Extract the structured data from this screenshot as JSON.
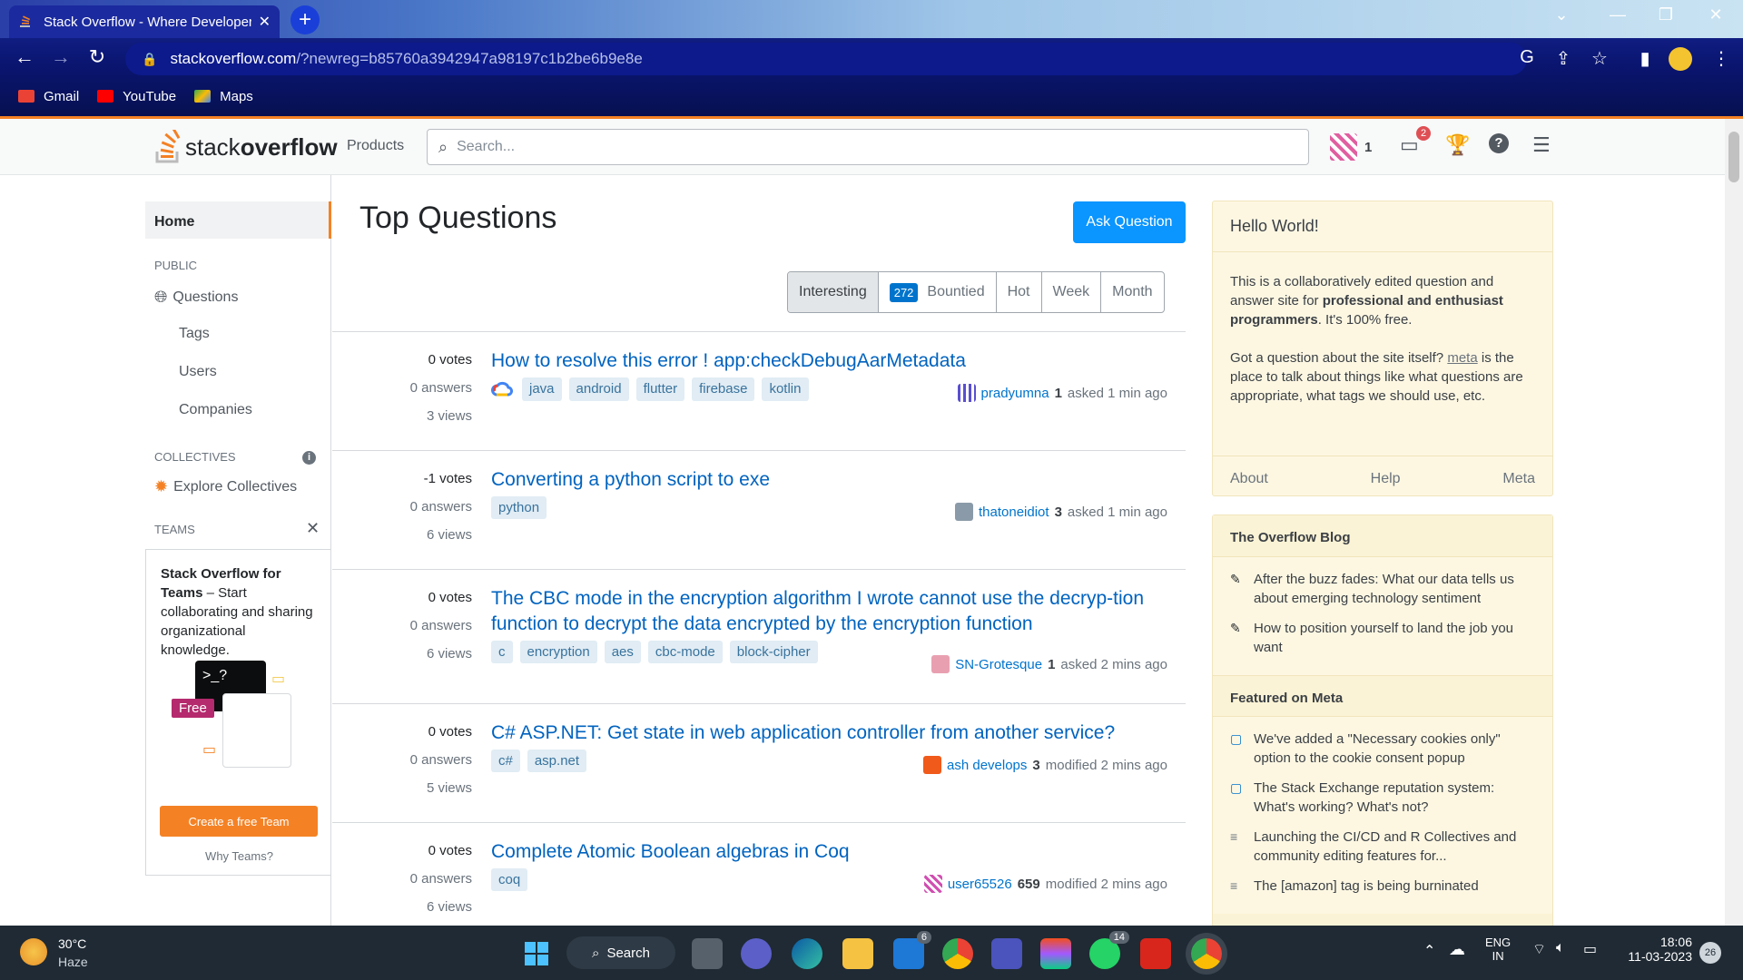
{
  "browser": {
    "tab_title": "Stack Overflow - Where Developers",
    "url_host": "stackoverflow.com",
    "url_path": "/?newreg=b85760a3942947a98197c1b2be6b9e8e",
    "bookmarks": [
      "Gmail",
      "YouTube",
      "Maps"
    ]
  },
  "header": {
    "logo_light": "stack",
    "logo_bold": "overflow",
    "products": "Products",
    "search_placeholder": "Search...",
    "rep": "1",
    "inbox_count": "2"
  },
  "leftnav": {
    "home": "Home",
    "public": "PUBLIC",
    "questions": "Questions",
    "tags": "Tags",
    "users": "Users",
    "companies": "Companies",
    "collectives": "COLLECTIVES",
    "explore": "Explore Collectives",
    "teams": "TEAMS",
    "teams_title": "Stack Overflow for Teams",
    "teams_desc": " – Start collaborating and sharing organizational knowledge.",
    "free": "Free",
    "create_team": "Create a free Team",
    "why_teams": "Why Teams?"
  },
  "main": {
    "title": "Top Questions",
    "ask": "Ask Question",
    "filters": [
      "Interesting",
      "Bountied",
      "Hot",
      "Week",
      "Month"
    ],
    "bounty_count": "272"
  },
  "questions": [
    {
      "votes": "0 votes",
      "answers": "0 answers",
      "views": "3 views",
      "title": "How to resolve this error ! app:checkDebugAarMetadata",
      "tags": [
        "java",
        "android",
        "flutter",
        "firebase",
        "kotlin"
      ],
      "user": "pradyumna",
      "rep": "1",
      "action": "asked 1 min ago"
    },
    {
      "votes": "-1 votes",
      "answers": "0 answers",
      "views": "6 views",
      "title": "Converting a python script to exe",
      "tags": [
        "python"
      ],
      "user": "thatoneidiot",
      "rep": "3",
      "action": "asked 1 min ago"
    },
    {
      "votes": "0 votes",
      "answers": "0 answers",
      "views": "6 views",
      "title": "The CBC mode in the encryption algorithm I wrote cannot use the decryp-tion function to decrypt the data encrypted by the encryption function",
      "tags": [
        "c",
        "encryption",
        "aes",
        "cbc-mode",
        "block-cipher"
      ],
      "user": "SN-Grotesque",
      "rep": "1",
      "action": "asked 2 mins ago"
    },
    {
      "votes": "0 votes",
      "answers": "0 answers",
      "views": "5 views",
      "title": "C# ASP.NET: Get state in web application controller from another service?",
      "tags": [
        "c#",
        "asp.net"
      ],
      "user": "ash develops",
      "rep": "3",
      "action": "modified 2 mins ago"
    },
    {
      "votes": "0 votes",
      "answers": "0 answers",
      "views": "6 views",
      "title": "Complete Atomic Boolean algebras in Coq",
      "tags": [
        "coq"
      ],
      "user": "user65526",
      "rep": "659",
      "action": "modified 2 mins ago"
    }
  ],
  "sidebar": {
    "hello_title": "Hello World!",
    "p1_a": "This is a collaboratively edited question and answer site for ",
    "p1_b": "professional and enthusiast programmers",
    "p1_c": ". It's 100% free.",
    "p2_a": "Got a question about the site itself? ",
    "p2_link": "meta",
    "p2_b": " is the place to talk about things like what questions are appropriate, what tags we should use, etc.",
    "footer": [
      "About",
      "Help",
      "Meta"
    ],
    "blog_title": "The Overflow Blog",
    "blog_items": [
      "After the buzz fades: What our data tells us about emerging technology sentiment",
      "How to position yourself to land the job you want"
    ],
    "meta_title": "Featured on Meta",
    "meta_items": [
      "We've added a \"Necessary cookies only\" option to the cookie consent popup",
      "The Stack Exchange reputation system: What's working? What's not?",
      "Launching the CI/CD and R Collectives and community editing features for...",
      "The [amazon] tag is being burninated"
    ]
  },
  "taskbar": {
    "temp": "30°C",
    "weather": "Haze",
    "search": "Search",
    "lang1": "ENG",
    "lang2": "IN",
    "time": "18:06",
    "date": "11-03-2023",
    "notif": "26",
    "badge_mail": "6",
    "badge_whatsapp": "14"
  }
}
